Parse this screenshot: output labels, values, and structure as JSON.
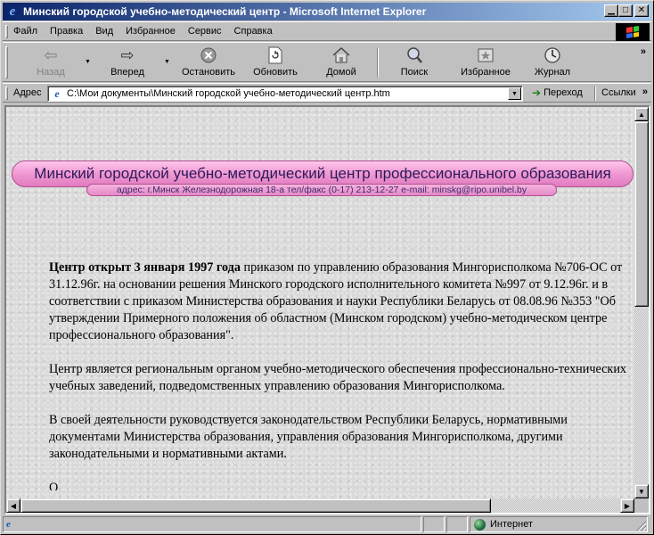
{
  "window": {
    "title": "Минский городской учебно-методический центр - Microsoft Internet Explorer",
    "app_icon": "ie-icon",
    "buttons": [
      "minimize-icon",
      "maximize-icon",
      "close-icon"
    ]
  },
  "menu": {
    "items": [
      {
        "label": "Файл"
      },
      {
        "label": "Правка"
      },
      {
        "label": "Вид"
      },
      {
        "label": "Избранное"
      },
      {
        "label": "Сервис"
      },
      {
        "label": "Справка"
      }
    ]
  },
  "toolbar": {
    "back": {
      "label": "Назад",
      "icon": "back-arrow-icon",
      "disabled": true
    },
    "forward": {
      "label": "Вперед",
      "icon": "forward-arrow-icon"
    },
    "stop": {
      "label": "Остановить",
      "icon": "stop-icon"
    },
    "refresh": {
      "label": "Обновить",
      "icon": "refresh-icon"
    },
    "home": {
      "label": "Домой",
      "icon": "home-icon"
    },
    "search": {
      "label": "Поиск",
      "icon": "search-icon"
    },
    "favorites": {
      "label": "Избранное",
      "icon": "favorites-icon"
    },
    "history": {
      "label": "Журнал",
      "icon": "history-icon"
    },
    "overflow": "»"
  },
  "address": {
    "label": "Адрес",
    "url": "C:\\Мои документы\\Минский городской учебно-методический центр.htm",
    "go_label": "Переход",
    "links_label": "Ссылки",
    "links_overflow": "»"
  },
  "page": {
    "banner_title": "Минский городской учебно-методический центр профессионального образования",
    "banner_subtitle": "адрес: г.Минск Железнодорожная 18-а тел/факс (0-17) 213-12-27 e-mail: minskg@ripo.unibel.by",
    "paragraph1_bold": "Центр открыт 3 января 1997 года",
    "paragraph1_rest": " приказом по управлению образования Мингорисполкома №706-ОС от 31.12.96г. на основании решения Минского городского исполнительного комитета №997 от 9.12.96г. и в соответствии с приказом Министерства образования и науки Республики Беларусь от 08.08.96 №353 \"Об утверждении Примерного положения об областном (Минском городском) учебно-методическом центре профессионального образования\".",
    "paragraph2": "Центр является региональным органом учебно-методического обеспечения профессионально-технических учебных заведений, подведомственных управлению образования Мингорисполкома.",
    "paragraph3": "В своей деятельности руководствуется законодательством Республики Беларусь, нормативными документами Министерства образования, управления образования Мингорисполкома, другими законодательными и нормативными актами.",
    "paragraph4_partial": "О"
  },
  "status": {
    "zone": "Интернет"
  },
  "colors": {
    "titlebar_start": "#0a246a",
    "titlebar_end": "#a6caf0",
    "banner_pink": "#f19bd3",
    "chrome": "#c0c0c0"
  }
}
